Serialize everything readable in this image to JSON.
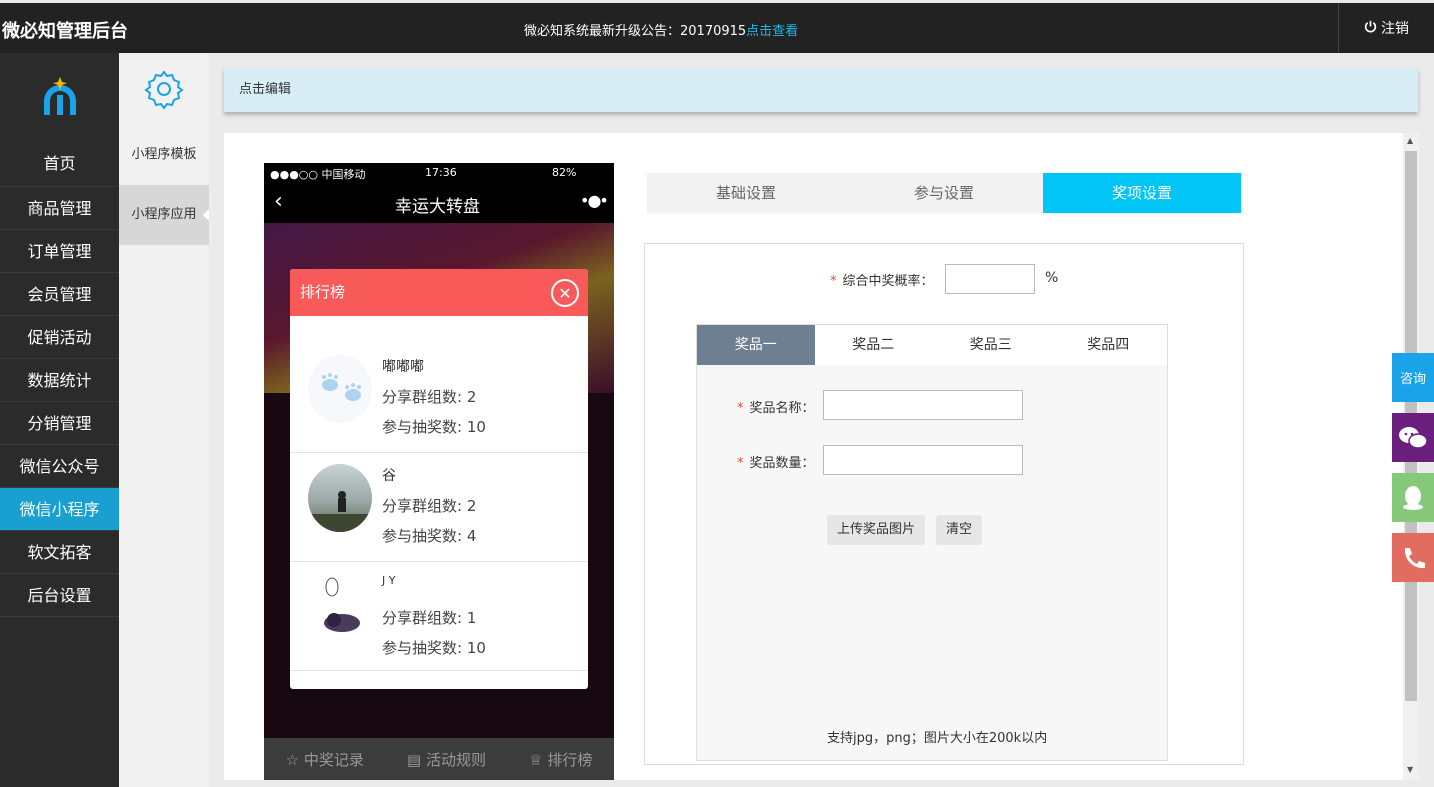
{
  "header": {
    "brand": "微必知管理后台",
    "notice_text": "微必知系统最新升级公告：20170915",
    "notice_link": "点击查看",
    "logout": "注销"
  },
  "sidebar": {
    "items": [
      {
        "label": "首页"
      },
      {
        "label": "商品管理"
      },
      {
        "label": "订单管理"
      },
      {
        "label": "会员管理"
      },
      {
        "label": "促销活动"
      },
      {
        "label": "数据统计"
      },
      {
        "label": "分销管理"
      },
      {
        "label": "微信公众号"
      },
      {
        "label": "微信小程序",
        "active": true
      },
      {
        "label": "软文拓客"
      },
      {
        "label": "后台设置"
      }
    ]
  },
  "subsidebar": {
    "items": [
      {
        "label": "小程序模板"
      },
      {
        "label": "小程序应用",
        "active": true
      }
    ]
  },
  "editbar": {
    "label": "点击编辑"
  },
  "phone": {
    "carrier": "●●●○○ 中国移动",
    "time": "17:36",
    "battery": "82%",
    "title": "幸运大转盘",
    "ranking": {
      "title": "排行榜",
      "rows": [
        {
          "name": "嘟嘟嘟",
          "share_label": "分享群组数:",
          "share": "2",
          "draw_label": "参与抽奖数:",
          "draw": "10"
        },
        {
          "name": "谷",
          "share_label": "分享群组数:",
          "share": "2",
          "draw_label": "参与抽奖数:",
          "draw": "4"
        },
        {
          "name": "J Y",
          "share_label": "分享群组数:",
          "share": "1",
          "draw_label": "参与抽奖数:",
          "draw": "10"
        }
      ]
    },
    "bottom": [
      "中奖记录",
      "活动规则",
      "排行榜"
    ]
  },
  "settings": {
    "tabs": [
      "基础设置",
      "参与设置",
      "奖项设置"
    ],
    "active_tab": 2,
    "rate_label": "综合中奖概率：",
    "rate_value": "",
    "rate_unit": "%",
    "prize_tabs": [
      "奖品一",
      "奖品二",
      "奖品三",
      "奖品四"
    ],
    "prize_name_label": "奖品名称：",
    "prize_count_label": "奖品数量：",
    "upload_button": "上传奖品图片",
    "clear_button": "清空",
    "hint": "支持jpg，png；图片大小在200k以内"
  },
  "float_buttons": {
    "consult": "咨询"
  },
  "colors": {
    "accent": "#00c5f5",
    "nav_active": "#19a0d0",
    "ranking_header": "#f85a5a"
  }
}
